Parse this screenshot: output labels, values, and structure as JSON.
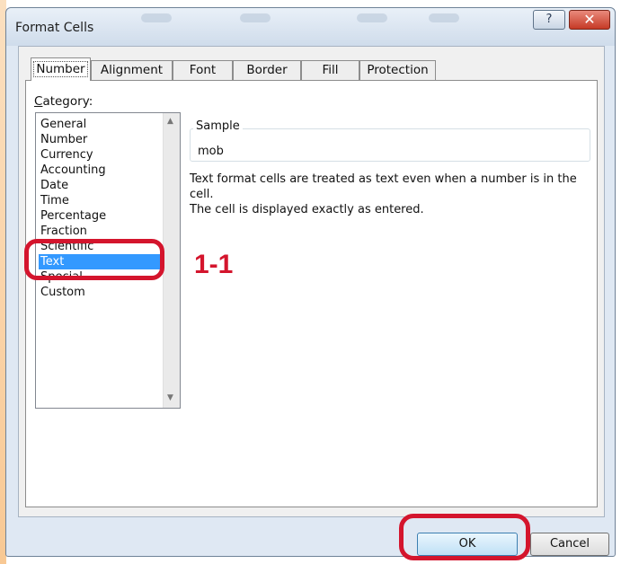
{
  "dialog": {
    "title": "Format Cells",
    "help_glyph": "?",
    "close_glyph": "✕"
  },
  "tabs": [
    {
      "label": "Number",
      "active": true
    },
    {
      "label": "Alignment",
      "active": false
    },
    {
      "label": "Font",
      "active": false
    },
    {
      "label": "Border",
      "active": false
    },
    {
      "label": "Fill",
      "active": false
    },
    {
      "label": "Protection",
      "active": false
    }
  ],
  "category": {
    "label_prefix": "",
    "label_mnemonic": "C",
    "label_rest": "ategory:",
    "items": [
      "General",
      "Number",
      "Currency",
      "Accounting",
      "Date",
      "Time",
      "Percentage",
      "Fraction",
      "Scientific",
      "Text",
      "Special",
      "Custom"
    ],
    "selected": "Text"
  },
  "sample": {
    "legend": "Sample",
    "value": "mob"
  },
  "description": {
    "line1": "Text format cells are treated as text even when a number is in the cell.",
    "line2": "The cell is displayed exactly as entered."
  },
  "annotation": {
    "label": "1-1",
    "color": "#d4152d"
  },
  "buttons": {
    "ok": "OK",
    "cancel": "Cancel"
  },
  "colors": {
    "selection": "#3399ff",
    "highlight": "#d4152d",
    "side_stripe_orange": "#f39c3c",
    "side_stripe_red": "#e05a3a"
  },
  "icons": {
    "scroll_up": "▲",
    "scroll_down": "▼"
  }
}
